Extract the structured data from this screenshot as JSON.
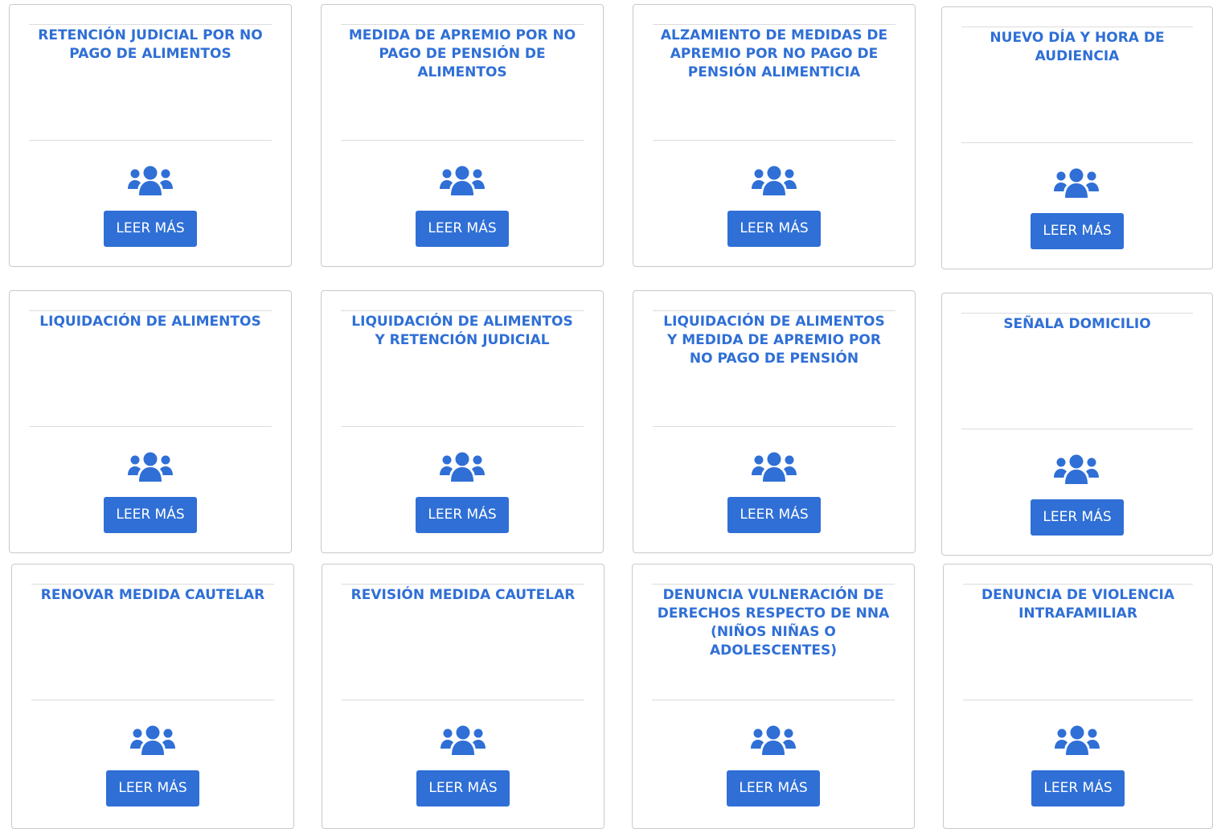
{
  "colors": {
    "accent": "#2f6fd6",
    "border": "#c9c9c9",
    "rule": "#dcdcdc"
  },
  "cards": [
    {
      "title": "RETENCIÓN JUDICIAL POR NO PAGO DE ALIMENTOS",
      "icon": "users-icon",
      "button_label": "LEER MÁS"
    },
    {
      "title": "MEDIDA DE APREMIO POR NO PAGO DE PENSIÓN DE ALIMENTOS",
      "icon": "users-icon",
      "button_label": "LEER MÁS"
    },
    {
      "title": "ALZAMIENTO DE MEDIDAS DE APREMIO POR NO PAGO DE PENSIÓN ALIMENTICIA",
      "icon": "users-icon",
      "button_label": "LEER MÁS"
    },
    {
      "title": "NUEVO DÍA Y HORA DE AUDIENCIA",
      "icon": "users-icon",
      "button_label": "LEER MÁS"
    },
    {
      "title": "LIQUIDACIÓN DE ALIMENTOS",
      "icon": "users-icon",
      "button_label": "LEER MÁS"
    },
    {
      "title": "LIQUIDACIÓN DE ALIMENTOS Y RETENCIÓN JUDICIAL",
      "icon": "users-icon",
      "button_label": "LEER MÁS"
    },
    {
      "title": "LIQUIDACIÓN DE ALIMENTOS Y MEDIDA DE APREMIO POR NO PAGO DE PENSIÓN",
      "icon": "users-icon",
      "button_label": "LEER MÁS"
    },
    {
      "title": "SEÑALA DOMICILIO",
      "icon": "users-icon",
      "button_label": "LEER MÁS"
    },
    {
      "title": "RENOVAR MEDIDA CAUTELAR",
      "icon": "users-icon",
      "button_label": "LEER MÁS"
    },
    {
      "title": "REVISIÓN MEDIDA CAUTELAR",
      "icon": "users-icon",
      "button_label": "LEER MÁS"
    },
    {
      "title": "DENUNCIA VULNERACIÓN DE DERECHOS RESPECTO DE NNA (NIÑOS NIÑAS O ADOLESCENTES)",
      "icon": "users-icon",
      "button_label": "LEER MÁS"
    },
    {
      "title": "DENUNCIA DE VIOLENCIA INTRAFAMILIAR",
      "icon": "users-icon",
      "button_label": "LEER MÁS"
    }
  ]
}
